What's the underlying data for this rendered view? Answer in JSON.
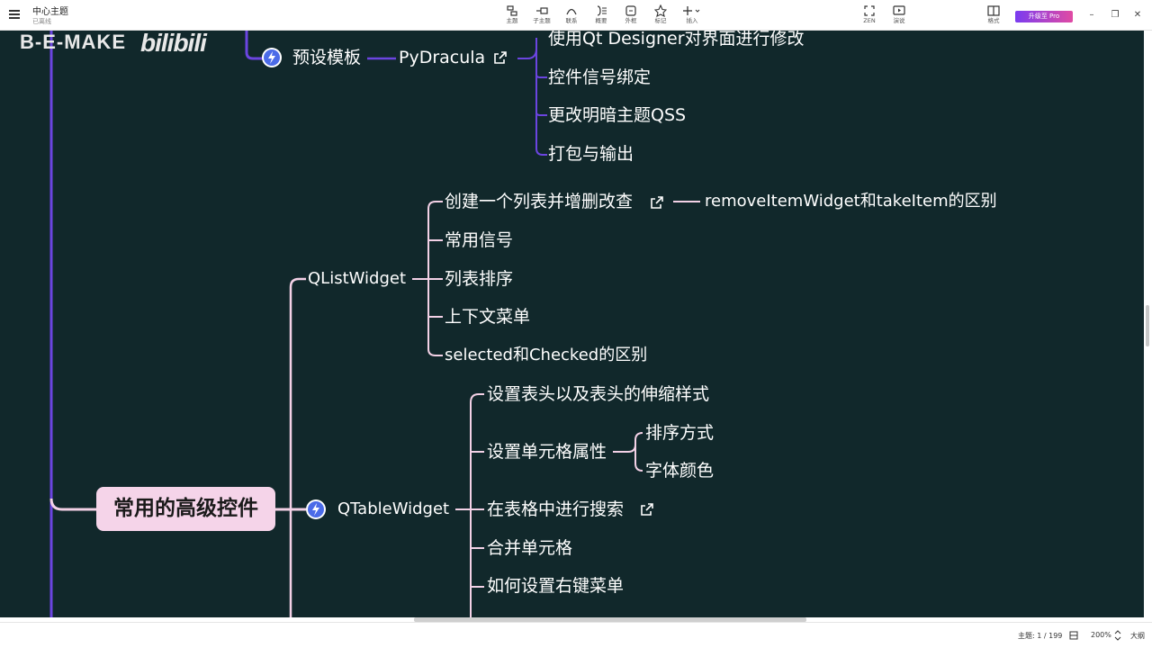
{
  "app": {
    "doc_title": "中心主题",
    "doc_status": "已离线"
  },
  "toolbar": {
    "tools": [
      {
        "icon": "topic-icon",
        "label": "主题"
      },
      {
        "icon": "subtopic-icon",
        "label": "子主题"
      },
      {
        "icon": "relationship-icon",
        "label": "联系"
      },
      {
        "icon": "summary-icon",
        "label": "概要"
      },
      {
        "icon": "boundary-icon",
        "label": "外框"
      },
      {
        "icon": "marker-icon",
        "label": "标记"
      },
      {
        "icon": "insert-icon",
        "label": "插入"
      }
    ],
    "zen_label": "ZEN",
    "present_label": "演说",
    "format_label": "格式",
    "upgrade_label": "升级至 Pro",
    "minimize": "–",
    "restore": "❐",
    "close": "✕"
  },
  "watermark": {
    "text": "B-E-MAKE",
    "logo": "bilibili"
  },
  "mindmap": {
    "central": "常用的高级控件",
    "preset_template": "预设模板",
    "pydracula": "PyDracula",
    "pydracula_children": [
      "使用Qt Designer对界面进行修改",
      "控件信号绑定",
      "更改明暗主题QSS",
      "打包与输出"
    ],
    "qlistwidget": "QListWidget",
    "qlistwidget_children": [
      "创建一个列表并增删改查",
      "常用信号",
      "列表排序",
      "上下文菜单",
      "selected和Checked的区别"
    ],
    "remove_item_note": "removeItemWidget和takeItem的区别",
    "qtablewidget": "QTableWidget",
    "qtablewidget_children": [
      "设置表头以及表头的伸缩样式",
      "设置单元格属性",
      "在表格中进行搜索",
      "合并单元格",
      "如何设置右键菜单"
    ],
    "cell_attr_children": [
      "排序方式",
      "字体颜色"
    ]
  },
  "statusbar": {
    "topic_count": "主题: 1 / 199",
    "zoom": "200%",
    "zoom_mode": "大纲"
  },
  "colors": {
    "canvas_bg": "#11282b",
    "branch_purple": "#6b45e0",
    "branch_pink": "#f3d1e6",
    "central_bg": "#f5d4e9",
    "bolt_blue": "#4b6be8"
  }
}
